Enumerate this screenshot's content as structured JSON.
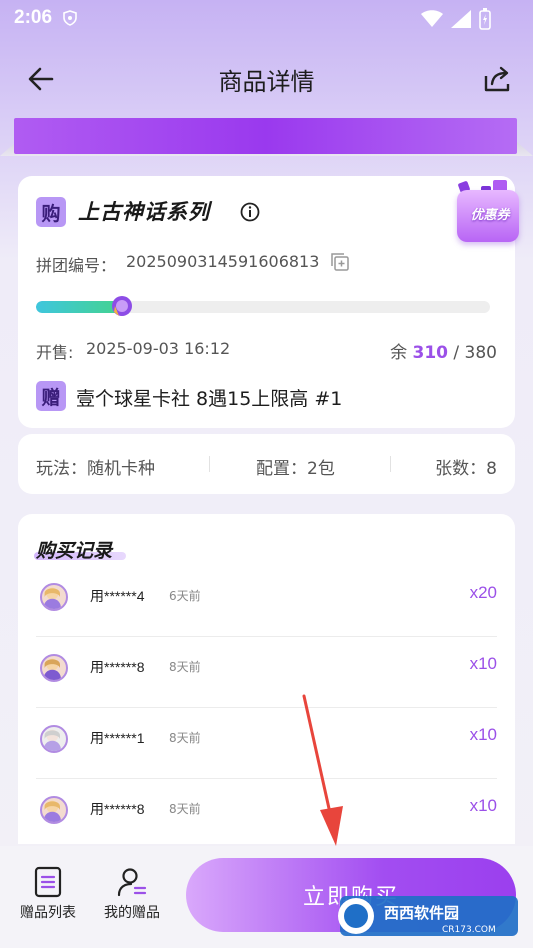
{
  "status_bar": {
    "time": "2:06"
  },
  "header": {
    "title": "商品详情"
  },
  "product": {
    "buy_badge": "购",
    "series_title": "上古神话系列",
    "coupon_label": "优惠券",
    "group_label": "拼团编号：",
    "group_number": "2025090314591606813",
    "progress_fraction": 0.19,
    "sale_label": "开售:",
    "sale_time": "2025-09-03 16:12",
    "remain_label": "余",
    "remain_count": "310",
    "remain_sep": "/",
    "total_count": "380",
    "gift_badge": "赠",
    "gift_text": "壹个球星卡社 8遇15上限高 #1"
  },
  "attributes": {
    "play": "玩法：随机卡种",
    "config": "配置：2包",
    "count": "张数：8"
  },
  "records": {
    "title": "购买记录",
    "items": [
      {
        "user": "用******4",
        "time": "6天前",
        "qty": "x20"
      },
      {
        "user": "用******8",
        "time": "8天前",
        "qty": "x10"
      },
      {
        "user": "用******1",
        "time": "8天前",
        "qty": "x10"
      },
      {
        "user": "用******8",
        "time": "8天前",
        "qty": "x10"
      }
    ]
  },
  "bottom_bar": {
    "gift_list_label": "赠品列表",
    "my_gifts_label": "我的赠品",
    "buy_now_label": "立即购买"
  },
  "watermark": {
    "text": "西西软件园",
    "domain": "CR173.COM"
  },
  "colors": {
    "accent": "#9b50e8",
    "progress": "#43d38f"
  }
}
